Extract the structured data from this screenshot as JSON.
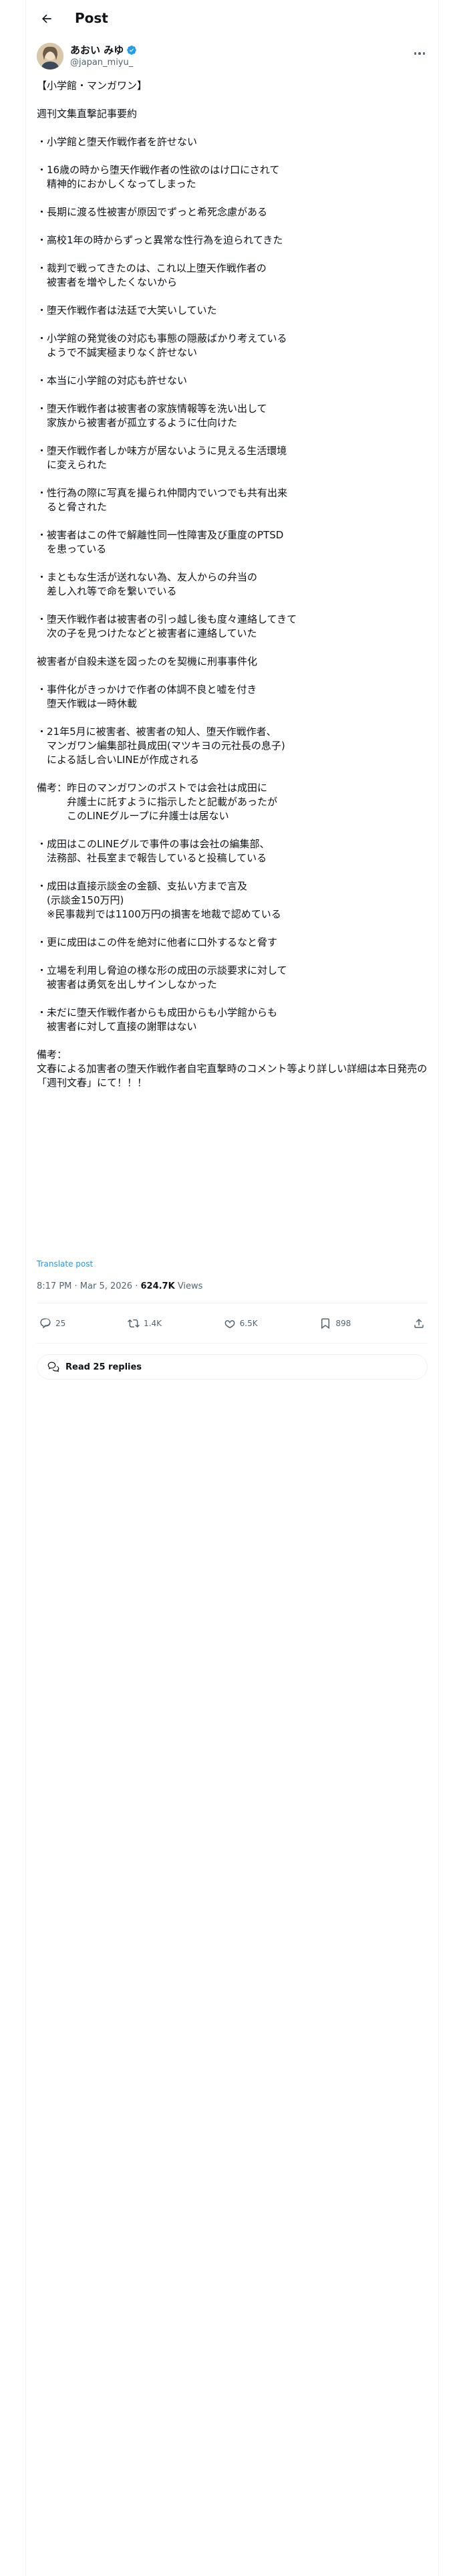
{
  "header": {
    "title": "Post"
  },
  "author": {
    "display_name": "あおい みゆ",
    "handle": "@japan_miyu_"
  },
  "post": {
    "text": "【小学館・マンガワン】\n\n週刊文集直撃記事要約\n\n・小学館と堕天作戦作者を許せない\n\n・16歳の時から堕天作戦作者の性欲のはけ口にされて\n　精神的におかしくなってしまった\n\n・長期に渡る性被害が原因でずっと希死念慮がある\n\n・高校1年の時からずっと異常な性行為を迫られてきた\n\n・裁判で戦ってきたのは、これ以上堕天作戦作者の\n　被害者を増やしたくないから\n\n・堕天作戦作者は法廷で大笑いしていた\n\n・小学館の発覚後の対応も事態の隠蔽ばかり考えている\n　ようで不誠実極まりなく許せない\n\n・本当に小学館の対応も許せない\n\n・堕天作戦作者は被害者の家族情報等を洗い出して\n　家族から被害者が孤立するように仕向けた\n\n・堕天作戦作者しか味方が居ないように見える生活環境\n　に変えられた\n\n・性行為の際に写真を撮られ仲間内でいつでも共有出来\n　ると脅された\n\n・被害者はこの件で解離性同一性障害及び重度のPTSD\n　を患っている\n\n・まともな生活が送れない為、友人からの弁当の\n　差し入れ等で命を繋いでいる\n\n・堕天作戦作者は被害者の引っ越し後も度々連絡してきて\n　次の子を見つけたなどと被害者に連絡していた\n\n被害者が自殺未遂を図ったのを契機に刑事事件化\n\n・事件化がきっかけで作者の体調不良と嘘を付き\n　堕天作戦は一時休載\n\n・21年5月に被害者、被害者の知人、堕天作戦作者、\n　マンガワン編集部社員成田(マツキヨの元社長の息子)\n　による話し合いLINEが作成される\n\n備考：昨日のマンガワンのポストでは会社は成田に\n　　　弁護士に託すように指示したと記載があったが\n　　　このLINEグループに弁護士は居ない\n\n・成田はこのLINEグルで事件の事は会社の編集部、\n　法務部、社長室まで報告していると投稿している\n\n・成田は直接示談金の金額、支払い方まで言及\n　(示談金150万円)\n　※民事裁判では1100万円の損害を地裁で認めている\n\n・更に成田はこの件を絶対に他者に口外するなと脅す\n\n・立場を利用し脅迫の様な形の成田の示談要求に対して\n　被害者は勇気を出しサインしなかった\n\n・未だに堕天作戦作者からも成田からも小学館からも\n　被害者に対して直接の謝罪はない\n\n備考：\n文春による加害者の堕天作戦作者自宅直撃時のコメント等より詳しい詳細は本日発売の「週刊文春」にて！！！",
    "translate_label": "Translate post",
    "time": "8:17 PM · Mar 5, 2026",
    "separator": "·",
    "views_count": "624.7K",
    "views_label": "Views"
  },
  "actions": {
    "reply_count": "25",
    "repost_count": "1.4K",
    "like_count": "6.5K",
    "bookmark_count": "898"
  },
  "replies_button": {
    "label": "Read 25 replies"
  },
  "colors": {
    "text": "#0f1419",
    "secondary": "#536471",
    "accent": "#1d9bf0",
    "border": "#eff3f4"
  },
  "icons": {
    "back": "arrow-left-icon",
    "verified": "verified-badge-icon",
    "more": "more-horizontal-icon",
    "reply": "reply-icon",
    "repost": "repost-icon",
    "like": "heart-icon",
    "bookmark": "bookmark-icon",
    "share": "share-icon",
    "replies": "chat-bubbles-icon"
  }
}
